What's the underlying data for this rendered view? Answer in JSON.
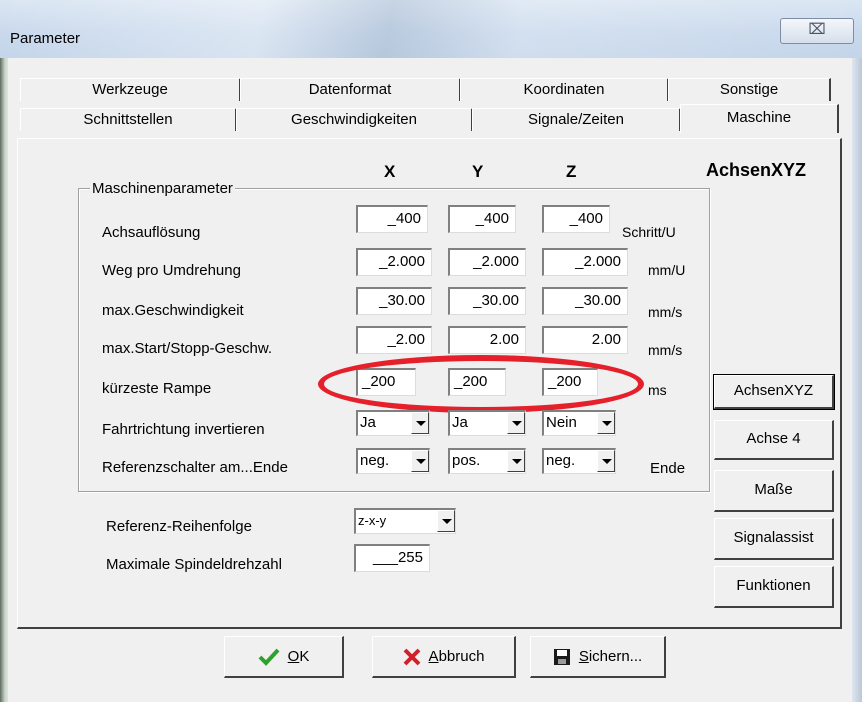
{
  "window": {
    "title": "Parameter",
    "close_glyph": "⌧"
  },
  "tabs": {
    "row1": [
      "Werkzeuge",
      "Datenformat",
      "Koordinaten",
      "Sonstige"
    ],
    "row2": [
      "Schnittstellen",
      "Geschwindigkeiten",
      "Signale/Zeiten",
      "Maschine"
    ],
    "active": "Maschine"
  },
  "axes": {
    "x": "X",
    "y": "Y",
    "z": "Z",
    "name": "AchsenXYZ"
  },
  "group_title": "Maschinenparameter",
  "params": [
    {
      "label": "Achsauflösung",
      "x": "_400",
      "y": "_400",
      "z": "_400",
      "unit": "Schritt/U"
    },
    {
      "label": "Weg pro Umdrehung",
      "x": "_2.000",
      "y": "_2.000",
      "z": "_2.000",
      "unit": "mm/U"
    },
    {
      "label": "max.Geschwindigkeit",
      "x": "_30.00",
      "y": "_30.00",
      "z": "_30.00",
      "unit": "mm/s"
    },
    {
      "label": "max.Start/Stopp-Geschw.",
      "x": "_2.00",
      "y": "2.00",
      "z": "2.00",
      "unit": "mm/s"
    },
    {
      "label": "kürzeste Rampe",
      "x": "_200",
      "y": "_200",
      "z": "_200",
      "unit": "ms"
    }
  ],
  "direction": {
    "label": "Fahrtrichtung invertieren",
    "x": "Ja",
    "y": "Ja",
    "z": "Nein"
  },
  "reference": {
    "label": "Referenzschalter am...Ende",
    "x": "neg.",
    "y": "pos.",
    "z": "neg.",
    "unit": "Ende"
  },
  "order": {
    "label": "Referenz-Reihenfolge",
    "value": "z-x-y"
  },
  "spindle": {
    "label": "Maximale Spindeldrehzahl",
    "value": "___255"
  },
  "side_buttons": [
    "AchsenXYZ",
    "Achse 4",
    "Maße",
    "Signalassist",
    "Funktionen"
  ],
  "bottom_buttons": {
    "ok": {
      "label": "OK",
      "underline": "O",
      "rest": "K"
    },
    "cancel": {
      "label": "Abbruch",
      "underline": "A",
      "rest": "bbruch"
    },
    "save": {
      "label": "Sichern...",
      "underline": "S",
      "rest": "ichern..."
    }
  },
  "colors": {
    "highlight_ellipse": "#e5202a",
    "ok_check": "#2ea02e",
    "cancel_x": "#d0202a"
  }
}
